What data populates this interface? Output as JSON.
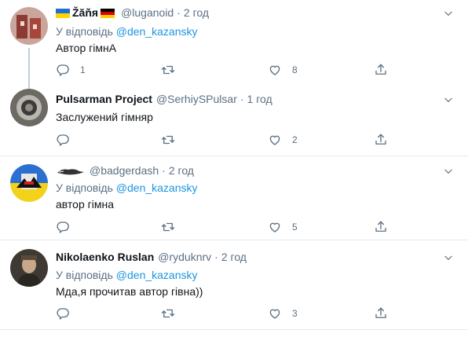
{
  "tweets": [
    {
      "name": "Žăňя",
      "handle": "@luganoid",
      "time": "2 год",
      "reply_prefix": "У відповідь",
      "reply_to": "@den_kazansky",
      "text": "Автор гімнА",
      "replies": "1",
      "retweets": "",
      "likes": "8"
    },
    {
      "name": "Pulsarman Project",
      "handle": "@SerhiySPulsar",
      "time": "1 год",
      "text": "Заслужений гімняр",
      "replies": "",
      "retweets": "",
      "likes": "2"
    },
    {
      "name": "",
      "handle": "@badgerdash",
      "time": "2 год",
      "reply_prefix": "У відповідь",
      "reply_to": "@den_kazansky",
      "text": "автор гімна",
      "replies": "",
      "retweets": "",
      "likes": "5"
    },
    {
      "name": "Nikolaenko Ruslan",
      "handle": "@ryduknrv",
      "time": "2 год",
      "reply_prefix": "У відповідь",
      "reply_to": "@den_kazansky",
      "text": "Мда,я прочитав автор гівна))",
      "replies": "",
      "retweets": "",
      "likes": "3"
    }
  ],
  "separator": "·",
  "icons": [
    "reply-icon",
    "retweet-icon",
    "like-icon",
    "share-icon",
    "chevron-down-icon"
  ],
  "colors": {
    "muted": "#5b7083",
    "link": "#1b95e0",
    "border": "#e6ecf0",
    "text": "#0f1419"
  }
}
